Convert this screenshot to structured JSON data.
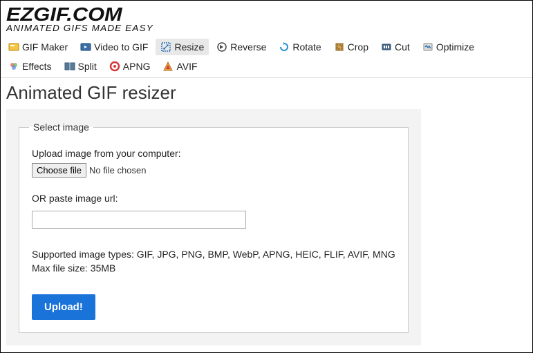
{
  "logo": {
    "main": "EZGIF.COM",
    "sub": "ANIMATED GIFS MADE EASY"
  },
  "nav": {
    "gif_maker": "GIF Maker",
    "video_to_gif": "Video to GIF",
    "resize": "Resize",
    "reverse": "Reverse",
    "rotate": "Rotate",
    "crop": "Crop",
    "cut": "Cut",
    "optimize": "Optimize",
    "effects": "Effects",
    "split": "Split",
    "apng": "APNG",
    "avif": "AVIF"
  },
  "page": {
    "title": "Animated GIF resizer"
  },
  "form": {
    "legend": "Select image",
    "upload_label": "Upload image from your computer:",
    "choose_file": "Choose file",
    "no_file": "No file chosen",
    "url_label": "OR paste image url:",
    "url_value": "",
    "supported": "Supported image types: GIF, JPG, PNG, BMP, WebP, APNG, HEIC, FLIF, AVIF, MNG",
    "max_size": "Max file size: 35MB",
    "upload_btn": "Upload!"
  }
}
